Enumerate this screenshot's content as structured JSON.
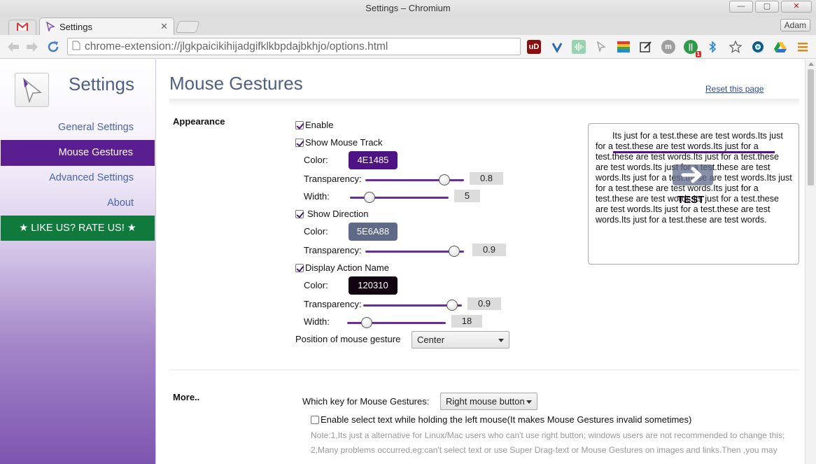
{
  "window": {
    "title": "Settings – Chromium",
    "min_label": "—",
    "max_label": "▢",
    "close_label": "✕"
  },
  "tabs": {
    "gmail_letter": "M",
    "active_title": "Settings",
    "close_glyph": "✕",
    "user_name": "Adam"
  },
  "toolbar": {
    "url": "chrome-extension://jlgkpaicikihijadgifklkbpdajbkhjo/options.html",
    "extensions": [
      "ublock-icon",
      "vivaldi-icon",
      "audio-icon",
      "gestures-icon",
      "colors-icon",
      "edit-icon",
      "m-icon",
      "pushbullet-icon",
      "bluetooth-icon",
      "bookmark-star-icon",
      "timer-icon",
      "drive-icon",
      "menu-icon"
    ],
    "ext_labels": {
      "ublock": "uD",
      "m": "m",
      "pushbullet_badge": "1"
    }
  },
  "colors": {
    "accent": "#5A1E91",
    "rate_green": "#0F7A3C",
    "track_color": "#4E1485",
    "direction_color": "#5E6A88",
    "action_color": "#120310"
  },
  "sidebar": {
    "title": "Settings",
    "items": [
      "General Settings",
      "Mouse Gestures",
      "Advanced Settings",
      "About"
    ],
    "active_item": "Mouse Gestures",
    "rate_label": "★ LIKE US? RATE US! ★"
  },
  "main": {
    "title": "Mouse Gestures",
    "reset_link": "Reset this page",
    "appearance": {
      "label": "Appearance",
      "enable": {
        "label": "Enable",
        "checked": true
      },
      "show_track": {
        "label": "Show Mouse Track",
        "checked": true,
        "color_label": "Color:",
        "color_value": "4E1485",
        "transparency_label": "Transparency:",
        "transparency_value": "0.8",
        "transparency_fraction": 0.8,
        "width_label": "Width:",
        "width_value": "5",
        "width_fraction": 0.2
      },
      "show_direction": {
        "label": "Show Direction",
        "checked": true,
        "color_label": "Color:",
        "color_value": "5E6A88",
        "transparency_label": "Transparency:",
        "transparency_value": "0.9",
        "transparency_fraction": 0.9
      },
      "display_action": {
        "label": "Display Action Name",
        "checked": true,
        "color_label": "Color:",
        "color_value": "120310",
        "transparency_label": "Transparency:",
        "transparency_value": "0.9",
        "transparency_fraction": 0.9,
        "width_label": "Width:",
        "width_value": "18",
        "width_fraction": 0.2
      },
      "position_label": "Position of mouse gesture",
      "position_value": "Center"
    },
    "preview": {
      "text": "Its just for a test.these are test words.Its just for a test.these are test words.Its just for a test.these are test words.Its just for a test.these are test words.Its just for a test.these are test words.Its just for a test.these are test words.Its just for a test.these are test words.Its just for a test.these are test words.Its just for a test.these are test words.Its just for a test.these are test words.Its just for a test.these are test words.",
      "action_name": "TEST"
    },
    "more": {
      "label": "More..",
      "key_label": "Which key for Mouse Gestures:",
      "key_value": "Right mouse button",
      "select_text_label": "Enable select text while holding the left mouse(It makes Mouse Gestures invalid sometimes)",
      "select_text_checked": false,
      "note_line1": "Note:1,Its just a alternative for Linux/Mac users who can't use right button; windows users are not recommended to change this;",
      "note_line2": "2,Many problems occurred,eg:can't select text or use Super Drag-text or Mouse Gestures on images and links.Then ,you may"
    }
  }
}
